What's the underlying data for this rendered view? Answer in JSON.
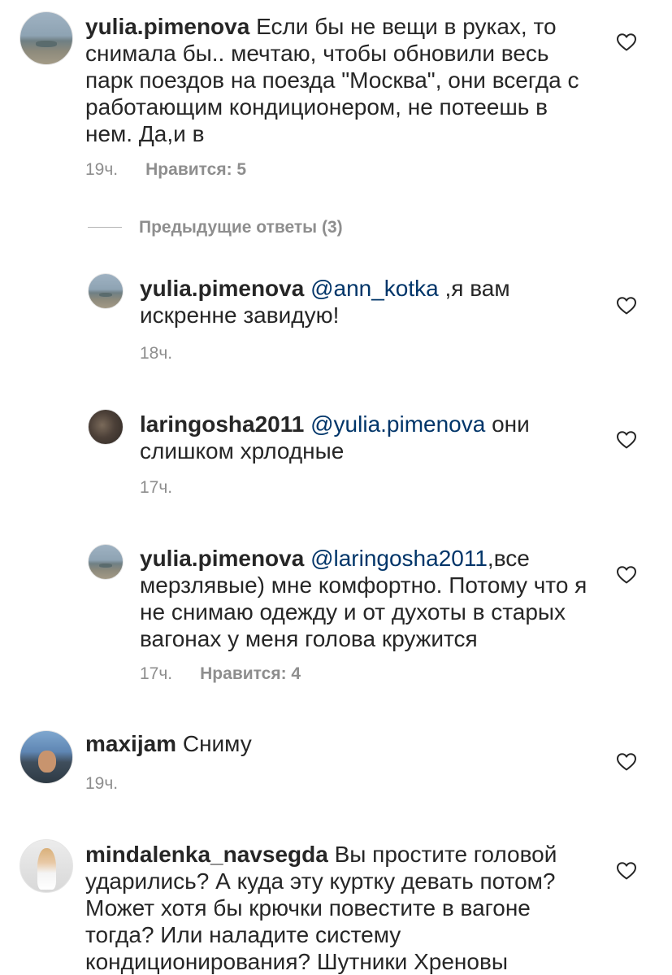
{
  "comments": [
    {
      "username": "yulia.pimenova",
      "mention": "",
      "text": "Если бы не вещи в руках, то снимала бы.. мечтаю, чтобы обновили весь парк поездов на поезда \"Москва\", они всегда с работающим кондиционером, не потеешь в нем. Да,и в",
      "time": "19ч.",
      "likes": "Нравится: 5",
      "avatar": "beach-photo"
    },
    {
      "username": "maxijam",
      "mention": "",
      "text": "Сниму",
      "time": "19ч.",
      "likes": "",
      "avatar": "man-portrait"
    },
    {
      "username": "mindalenka_navsegda",
      "mention": "",
      "text": "Вы простите головой ударились? А куда эту куртку девать потом? Может хотя бы крючки повестите в вагоне тогда? Или наладите систему кондиционирования? Шутники Хреновы",
      "time": "",
      "likes": "",
      "avatar": "woman-portrait"
    }
  ],
  "replies_toggle": "Предыдущие ответы (3)",
  "replies": [
    {
      "username": "yulia.pimenova",
      "mention": "@ann_kotka",
      "text": " ,я вам искренне завидую!",
      "time": "18ч.",
      "likes": "",
      "avatar": "beach-photo"
    },
    {
      "username": "laringosha2011",
      "mention": "@yulia.pimenova",
      "text": " они слишком хрлодные",
      "time": "17ч.",
      "likes": "",
      "avatar": "dark-portrait"
    },
    {
      "username": "yulia.pimenova",
      "mention": "@laringosha2011",
      "text": ",все мерзлявые) мне комфортно. Потому что я не снимаю одежду и от духоты в старых вагонах у меня голова кружится",
      "time": "17ч.",
      "likes": "Нравится: 4",
      "avatar": "beach-photo"
    }
  ],
  "icons": {
    "like": "heart-outline-icon"
  },
  "colors": {
    "text": "#262626",
    "meta": "#8e8e8e",
    "mention": "#003569"
  }
}
